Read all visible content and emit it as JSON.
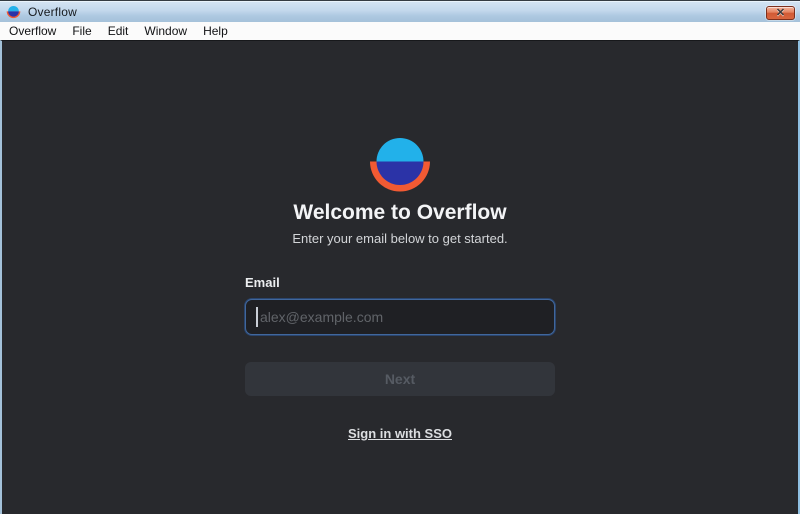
{
  "window": {
    "title": "Overflow",
    "close_glyph": "✕"
  },
  "menu_bar": {
    "items": [
      "Overflow",
      "File",
      "Edit",
      "Window",
      "Help"
    ]
  },
  "main": {
    "heading": "Welcome to Overflow",
    "subheading": "Enter your email below to get started.",
    "email_label": "Email",
    "email_value": "",
    "email_placeholder": "alex@example.com",
    "next_button_label": "Next",
    "sso_link_label": "Sign in with SSO"
  },
  "colors": {
    "content_bg": "#28292d",
    "logo_top": "#22b1ea",
    "logo_bottom": "#2b33a7",
    "logo_arc": "#f25a33",
    "input_focus_border": "#41679c",
    "titlebar_blue": "#bcd4e9",
    "close_button_red": "#d15a35"
  }
}
